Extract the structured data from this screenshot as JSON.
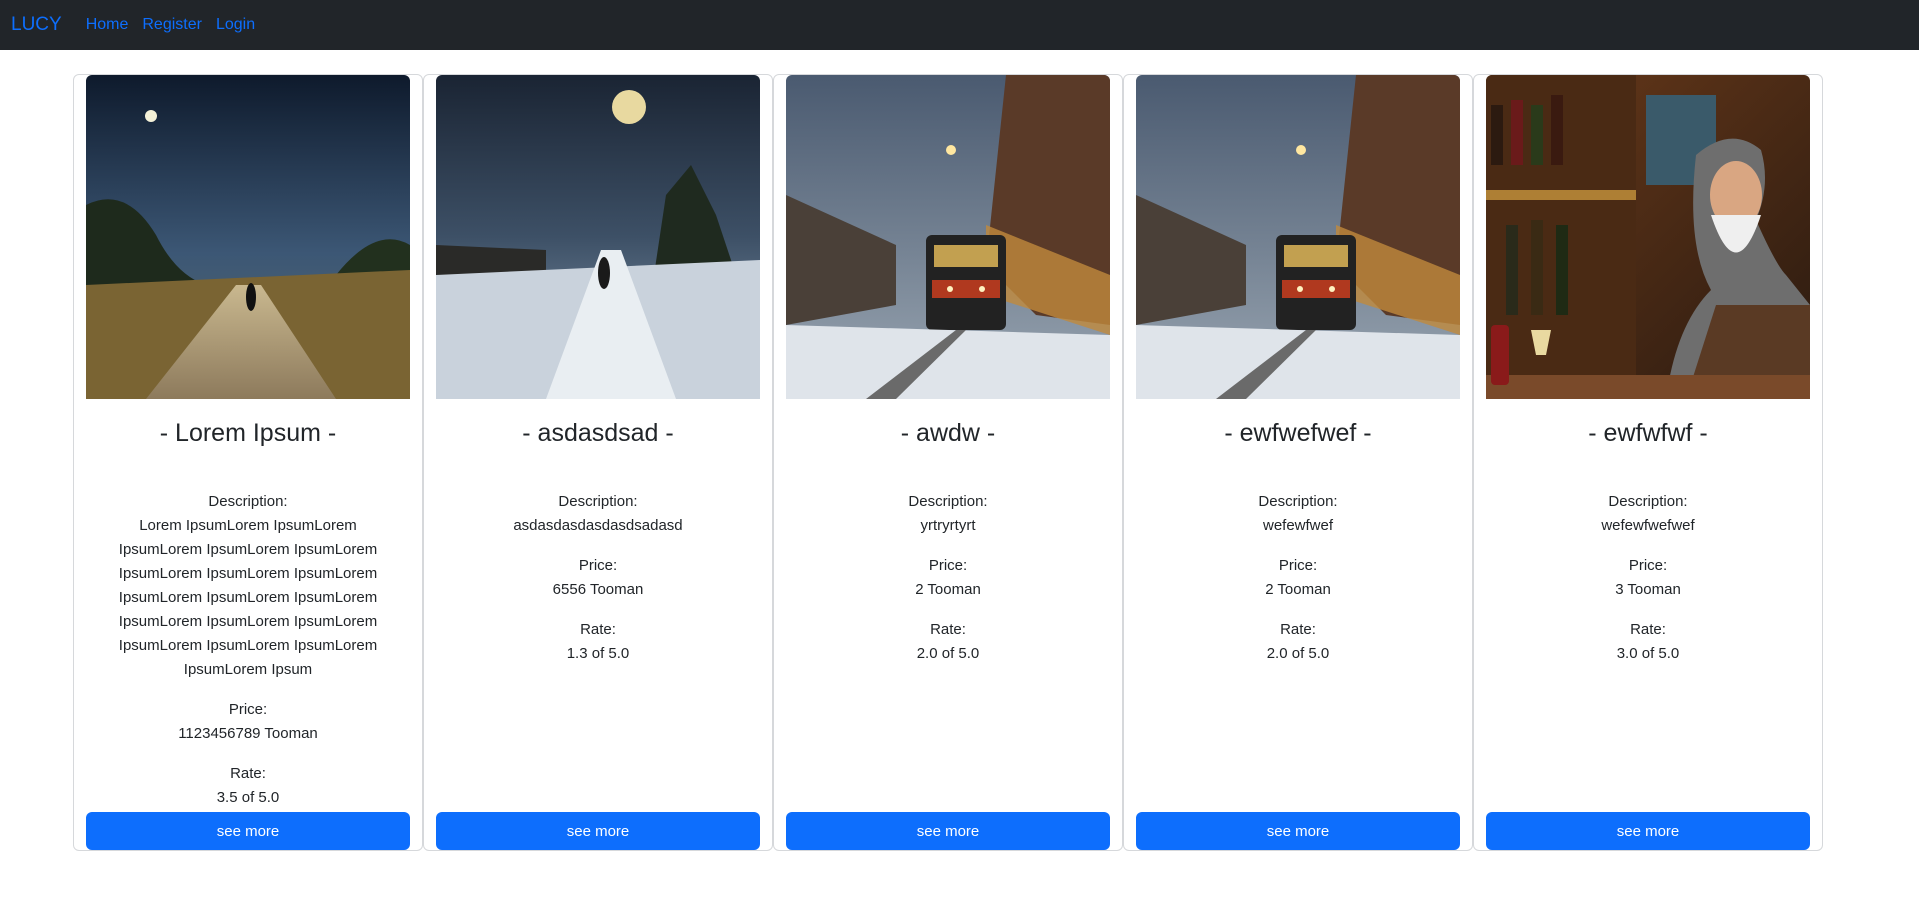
{
  "navbar": {
    "brand": "LUCY",
    "links": [
      "Home",
      "Register",
      "Login"
    ]
  },
  "labels": {
    "description": "Description:",
    "price": "Price:",
    "rate": "Rate:",
    "button": "see more"
  },
  "cards": [
    {
      "title": "- Lorem Ipsum -",
      "description": "Lorem IpsumLorem IpsumLorem IpsumLorem IpsumLorem IpsumLorem IpsumLorem IpsumLorem IpsumLorem IpsumLorem IpsumLorem IpsumLorem IpsumLorem IpsumLorem IpsumLorem IpsumLorem IpsumLorem IpsumLorem IpsumLorem Ipsum",
      "price": "1123456789 Tooman",
      "rate": "3.5 of 5.0",
      "image": "night-road-painting"
    },
    {
      "title": "- asdasdsad -",
      "description": "asdasdasdasdasdsadasd",
      "price": "6556 Tooman",
      "rate": "1.3 of 5.0",
      "image": "snowy-road-moon-painting"
    },
    {
      "title": "- awdw -",
      "description": "yrtryrtyrt",
      "price": "2 Tooman",
      "rate": "2.0 of 5.0",
      "image": "winter-train-station-painting"
    },
    {
      "title": "- ewfwefwef -",
      "description": "wefewfwef",
      "price": "2 Tooman",
      "rate": "2.0 of 5.0",
      "image": "winter-train-station-painting"
    },
    {
      "title": "- ewfwfwf -",
      "description": "wefewfwefwef",
      "price": "3 Tooman",
      "rate": "3.0 of 5.0",
      "image": "old-man-bar-painting"
    }
  ],
  "colors": {
    "navbar_bg": "#212529",
    "link": "#0d6efd",
    "button": "#0d6efd"
  }
}
